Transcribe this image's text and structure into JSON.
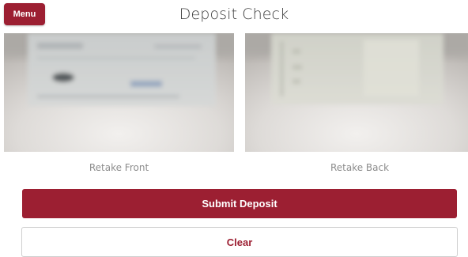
{
  "header": {
    "menu_label": "Menu",
    "title": "Deposit Check"
  },
  "photos": {
    "front": {
      "icon": "check-front-photo"
    },
    "back": {
      "icon": "check-back-photo"
    }
  },
  "retake": {
    "front_label": "Retake Front",
    "back_label": "Retake Back"
  },
  "actions": {
    "submit_label": "Submit Deposit",
    "clear_label": "Clear"
  },
  "colors": {
    "brand": "#9c1f32",
    "muted_text": "#8d8d8d",
    "title_text": "#3d3d3d"
  }
}
